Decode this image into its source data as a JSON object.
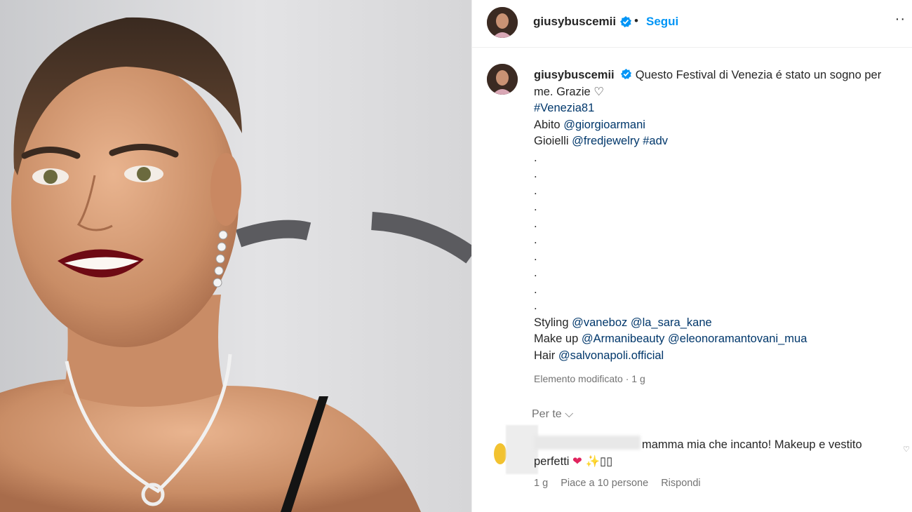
{
  "post": {
    "username": "giusybuscemii",
    "follow_label": "Segui",
    "separator": "•",
    "more_label": "··",
    "caption": {
      "text_line1": " Questo Festival di Venezia é stato un sogno per",
      "text_line2": "me. Grazie ",
      "heart": "♡",
      "hashtag": "#Venezia81",
      "abito_label": "Abito ",
      "abito_mention": "@giorgioarmani",
      "gioielli_label": "Gioielli ",
      "gioielli_mention": "@fredjewelry",
      "gioielli_tag": "#adv",
      "dots": [
        ".",
        ".",
        ".",
        ".",
        ".",
        ".",
        ".",
        ".",
        ".",
        "."
      ],
      "styling_label": "Styling ",
      "styling_mention1": "@vaneboz",
      "styling_mention2": "@la_sara_kane",
      "makeup_label": "Make up ",
      "makeup_mention1": "@Armanibeauty",
      "makeup_mention2": "@eleonoramantovani_mua",
      "hair_label": "Hair ",
      "hair_mention": "@salvonapoli.official"
    },
    "edited_meta": "Elemento modificato · 1 g",
    "per_te_label": "Per te ⌵"
  },
  "comment": {
    "username_blurred": "eleonoramantova",
    "text_line1": "mamma mia che incanto! Makeup e vestito",
    "text_line2": "perfetti ",
    "emoji_heart": "❤",
    "emoji_rest": "✨▯▯",
    "time": "1 g",
    "likes": "Piace a 10 persone",
    "reply": "Rispondi",
    "like_icon": "♡"
  },
  "colors": {
    "link": "#00376b",
    "follow": "#0095f6",
    "secondary": "#737373",
    "verified": "#0095f6"
  }
}
